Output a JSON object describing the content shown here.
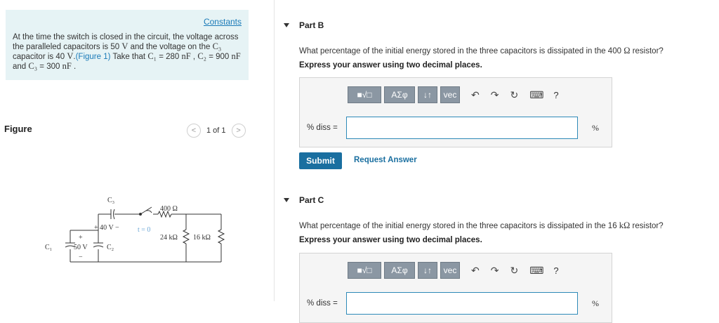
{
  "intro": {
    "constants_link": "Constants",
    "text_part1": "At the time the switch is closed in the circuit, the voltage across the paralleled capacitors is 50 ",
    "unit_V1": "V",
    "text_part2": " and the voltage on the ",
    "c3": "C₃",
    "text_part3": " capacitor is 40 ",
    "unit_V2": "V",
    "text_part4": ".",
    "figure_link": "(Figure 1)",
    "text_part5": " Take that ",
    "c1": "C₁",
    "text_part6": " = 280 ",
    "unit_nF1": "nF",
    "text_part7": " , ",
    "c2": "C₂",
    "text_part8": " = 900 ",
    "unit_nF2": "nF",
    "text_part9": " and ",
    "c3b": "C₃",
    "text_part10": " = 300 ",
    "unit_nF3": "nF",
    "text_part11": " ."
  },
  "figure": {
    "label": "Figure",
    "pager_text": "1 of 1",
    "prev": "<",
    "next": ">",
    "circuit_labels": {
      "c3": "C₃",
      "v40": "+ 40 V −",
      "t0": "t = 0",
      "r400": "400 Ω",
      "c1": "C₁",
      "v50": "50 V",
      "plus": "+",
      "minus": "−",
      "c2": "C₂",
      "r24": "24 kΩ",
      "r16": "16 kΩ"
    }
  },
  "partB": {
    "title": "Part B",
    "question_pre": "What percentage of the initial energy stored in the three capacitors is dissipated in the 400 ",
    "question_sym": "Ω",
    "question_post": " resistor?",
    "express": "Express your answer using two decimal places.",
    "toolbar": {
      "templates": "■√□",
      "greek": "AΣφ",
      "arrows": "↓↑",
      "vec": "vec",
      "undo": "↶",
      "redo": "↷",
      "reset": "↻",
      "keyboard": "⌨",
      "help": "?"
    },
    "answer_label": "% diss =",
    "unit": "%",
    "submit": "Submit",
    "request": "Request Answer"
  },
  "partC": {
    "title": "Part C",
    "question_pre": "What percentage of the initial energy stored in the three capacitors is dissipated in the 16 ",
    "question_sym": "kΩ",
    "question_post": " resistor?",
    "express": "Express your answer using two decimal places.",
    "toolbar": {
      "templates": "■√□",
      "greek": "AΣφ",
      "arrows": "↓↑",
      "vec": "vec",
      "undo": "↶",
      "redo": "↷",
      "reset": "↻",
      "keyboard": "⌨",
      "help": "?"
    },
    "answer_label": "% diss =",
    "unit": "%"
  }
}
